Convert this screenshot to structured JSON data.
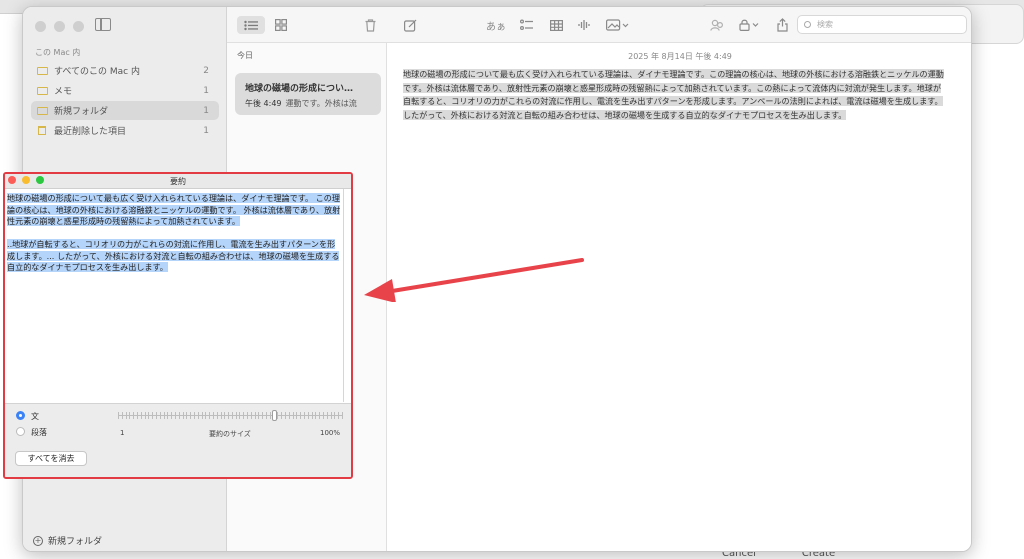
{
  "background": {
    "footer_buttons": [
      "Cancel",
      "Create"
    ]
  },
  "notes_app": {
    "sidebar": {
      "section_label": "この Mac 内",
      "items": [
        {
          "label": "すべてのこの Mac 内",
          "count": "2",
          "icon": "folder-icon"
        },
        {
          "label": "メモ",
          "count": "1",
          "icon": "folder-icon"
        },
        {
          "label": "新規フォルダ",
          "count": "1",
          "icon": "folder-icon",
          "selected": true
        },
        {
          "label": "最近削除した項目",
          "count": "1",
          "icon": "trash-icon"
        }
      ],
      "new_folder_label": "新規フォルダ"
    },
    "toolbar": {
      "format_label": "あぁ",
      "search_placeholder": "検索"
    },
    "note_list": {
      "date_header": "今日",
      "card": {
        "title": "地球の磁場の形成につい…",
        "time": "午後 4:49",
        "preview": "運動です。外核は流"
      }
    },
    "editor": {
      "date": "2025 年 8月14日 午後 4:49",
      "body": "地球の磁場の形成について最も広く受け入れられている理論は、ダイナモ理論です。この理論の核心は、地球の外核における溶融鉄とニッケルの運動です。外核は流体層であり、放射性元素の崩壊と惑星形成時の残留熱によって加熱されています。この熱によって流体内に対流が発生します。地球が自転すると、コリオリの力がこれらの対流に作用し、電流を生み出すパターンを形成します。アンペールの法則によれば、電流は磁場を生成します。したがって、外核における対流と自転の組み合わせは、地球の磁場を生成する自立的なダイナモプロセスを生み出します。"
    }
  },
  "summary_window": {
    "title": "要約",
    "paragraph1": "地球の磁場の形成について最も広く受け入れられている理論は、ダイナモ理論です。 この理論の核心は、地球の外核における溶融鉄とニッケルの運動です。 外核は流体層であり、放射性元素の崩壊と惑星形成時の残留熱によって加熱されています。",
    "paragraph2": "..地球が自転すると、コリオリの力がこれらの対流に作用し、電流を生み出すパターンを形成します。... したがって、外核における対流と自転の組み合わせは、地球の磁場を生成する自立的なダイナモプロセスを生み出します。",
    "option_sentence": "文",
    "option_paragraph": "段落",
    "selected_option": "文",
    "slider_min": "1",
    "slider_label": "要約のサイズ",
    "slider_max": "100%",
    "slider_value_fraction": 0.7,
    "clear_button": "すべてを消去"
  },
  "colors": {
    "highlight_border": "#e23b43",
    "selection": "#b5d4f9",
    "folder": "#d7b74a",
    "radio_on": "#3b82f6"
  }
}
